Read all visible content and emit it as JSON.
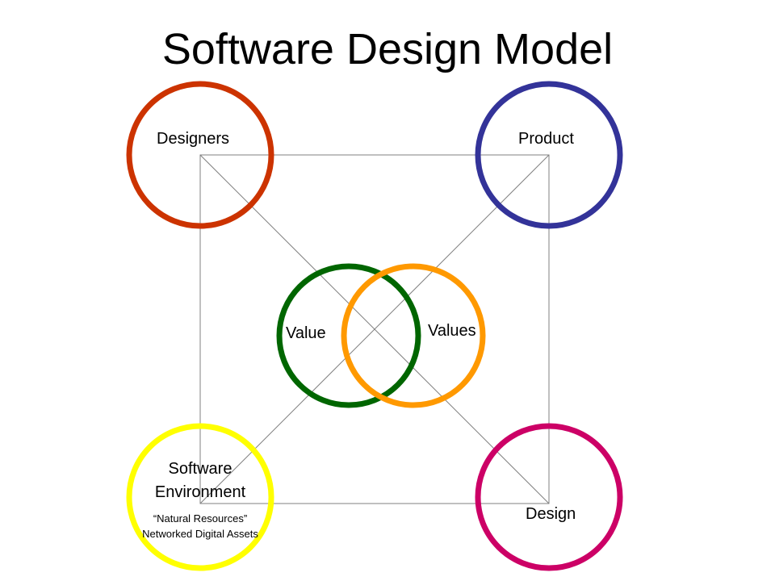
{
  "title": "Software Design Model",
  "nodes": {
    "designers": {
      "label": "Designers",
      "color": "#CC3300"
    },
    "product": {
      "label": "Product",
      "color": "#333399"
    },
    "software_environment": {
      "label_line1": "Software",
      "label_line2": "Environment",
      "note_line1": "“Natural Resources”",
      "note_line2": "Networked Digital Assets",
      "color": "#FFFF00"
    },
    "design": {
      "label": "Design",
      "color": "#CC0066"
    },
    "value": {
      "label": "Value",
      "color": "#006600"
    },
    "values": {
      "label": "Values",
      "color": "#FF9900"
    }
  },
  "frame_color": "#808080"
}
